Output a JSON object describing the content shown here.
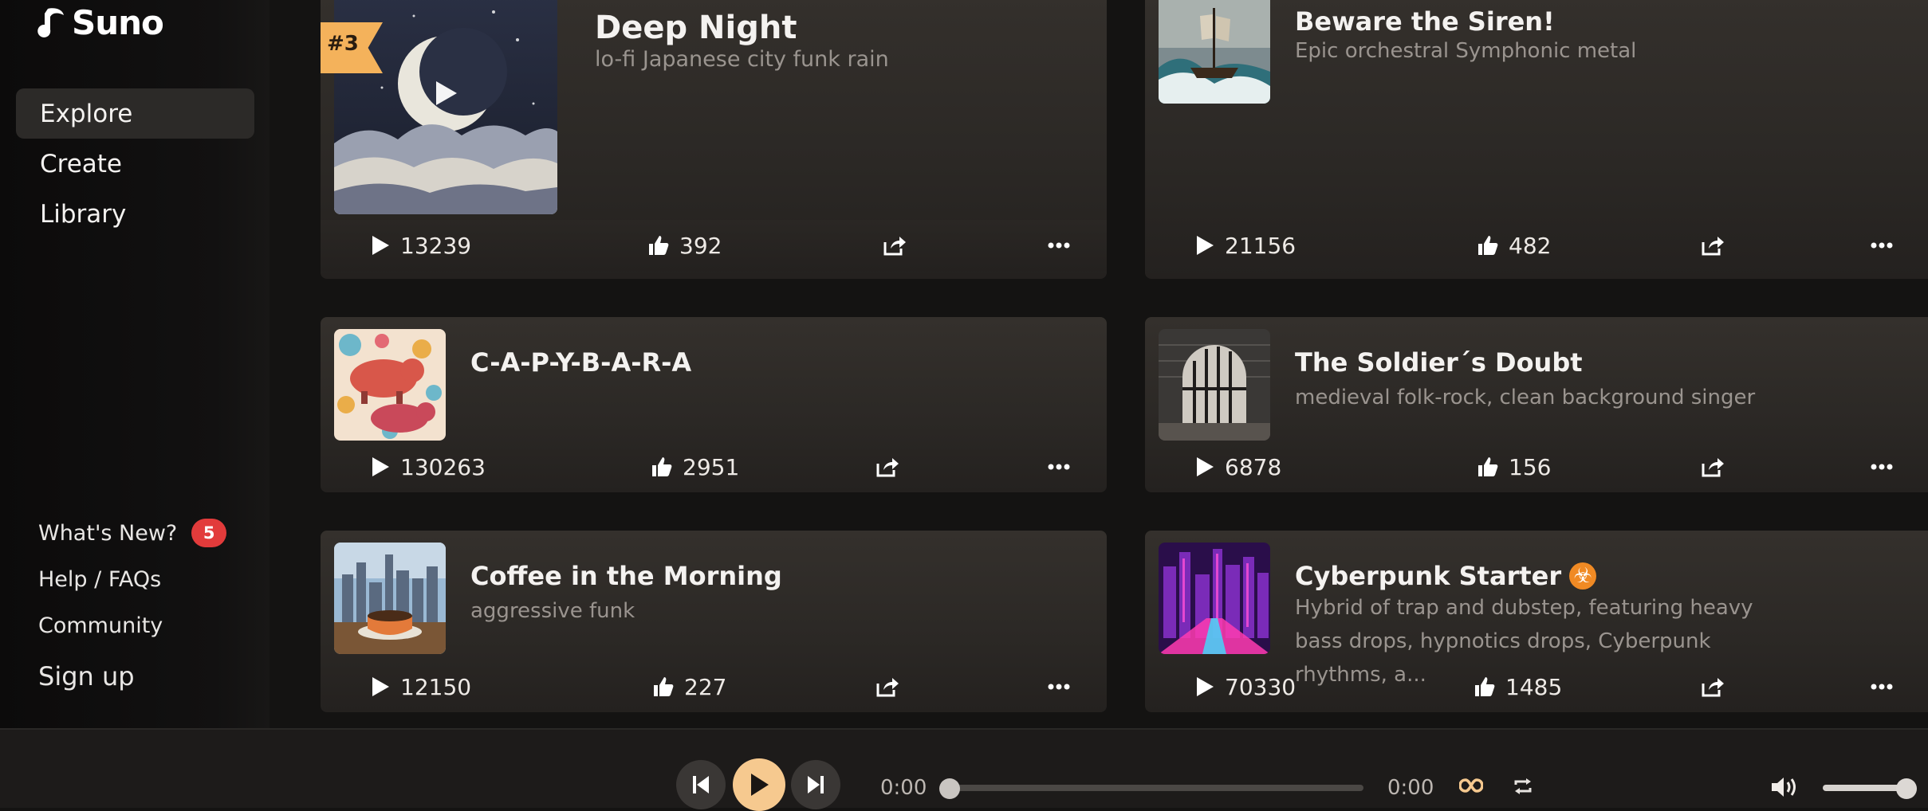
{
  "brand": {
    "name": "Suno"
  },
  "nav": {
    "items": [
      {
        "label": "Explore",
        "active": true
      },
      {
        "label": "Create",
        "active": false
      },
      {
        "label": "Library",
        "active": false
      }
    ]
  },
  "side_links": {
    "whats_new": "What's New?",
    "whats_new_badge": "5",
    "help": "Help / FAQs",
    "community": "Community",
    "signup": "Sign up"
  },
  "songs": [
    {
      "rank": "#3",
      "title": "Deep Night",
      "desc": "lo-fi Japanese city funk rain",
      "plays": "13239",
      "likes": "392"
    },
    {
      "title": "Beware the Siren!",
      "desc": "Epic orchestral Symphonic metal",
      "plays": "21156",
      "likes": "482"
    },
    {
      "title": "C-A-P-Y-B-A-R-A",
      "desc": "",
      "plays": "130263",
      "likes": "2951"
    },
    {
      "title": "The Soldier´s Doubt",
      "desc": "medieval folk-rock, clean background singer",
      "plays": "6878",
      "likes": "156"
    },
    {
      "title": "Coffee in the Morning",
      "desc": "aggressive funk",
      "plays": "12150",
      "likes": "227"
    },
    {
      "title": "Cyberpunk Starter",
      "title_emoji": "☣",
      "desc": "Hybrid of trap and dubstep, featuring heavy bass drops, hypnotics drops, Cyberpunk rhythms, a...",
      "plays": "70330",
      "likes": "1485"
    }
  ],
  "player": {
    "current_time": "0:00",
    "duration": "0:00",
    "progress": 0,
    "volume": 1.0
  },
  "colors": {
    "accent": "#f6c98f",
    "badge": "#e23b3b",
    "rank_tag": "#f4b25b"
  }
}
